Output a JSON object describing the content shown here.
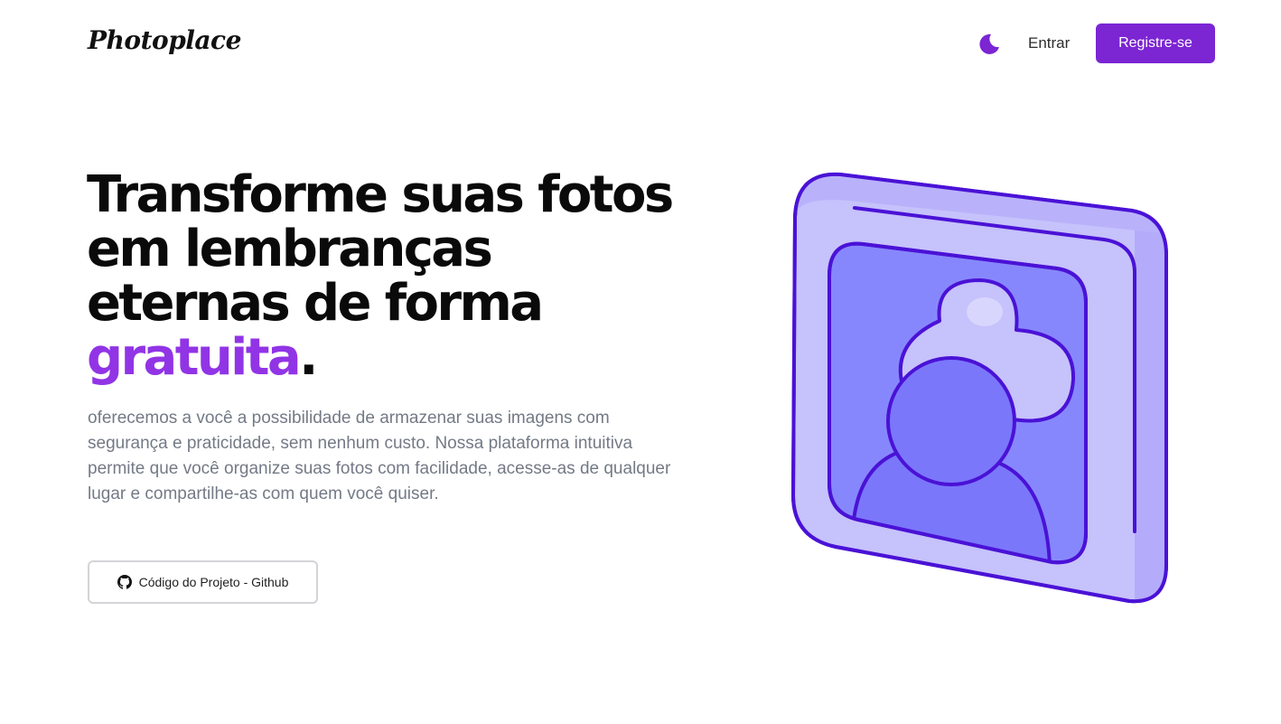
{
  "header": {
    "logo": "Photoplace",
    "theme_toggle_icon": "moon-icon",
    "login_label": "Entrar",
    "register_label": "Registre-se"
  },
  "hero": {
    "headline_lines": [
      "Transforme suas fotos",
      "em lembranças",
      "eternas de forma"
    ],
    "headline_accent": "gratuita",
    "headline_end": ".",
    "description": "oferecemos a você a possibilidade de armazenar suas imagens com segurança e praticidade, sem nenhum custo. Nossa plataforma intuitiva permite que você organize suas fotos com facilidade, acesse-as de qualquer lugar e compartilhe-as com quem você quiser.",
    "github_button_label": "Código do Projeto - Github",
    "github_icon": "github-icon",
    "illustration_icon": "photo-frame-icon"
  },
  "colors": {
    "accent": "#7b25d3",
    "accent_text": "#9134e6",
    "frame_outline": "#4a12d6",
    "frame_face": "#c6c2fb",
    "frame_inner": "#8787fd",
    "frame_person": "#7b77fb"
  }
}
